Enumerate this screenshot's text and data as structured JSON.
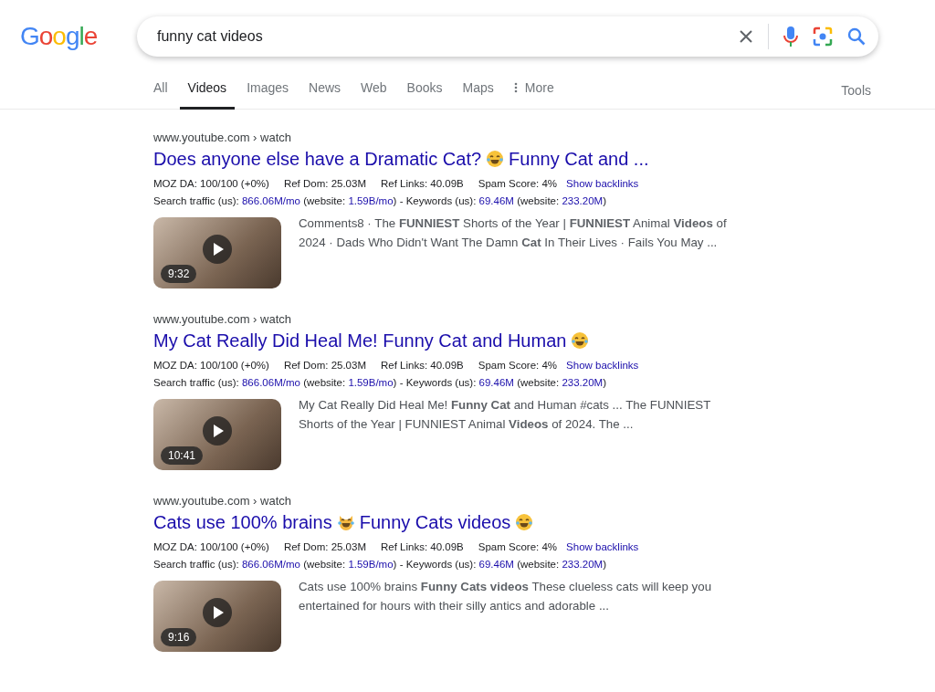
{
  "logo": {
    "letters": [
      "G",
      "o",
      "o",
      "g",
      "l",
      "e"
    ]
  },
  "search": {
    "value": "funny cat videos"
  },
  "tabs": [
    {
      "label": "All",
      "selected": false,
      "kind": "tab"
    },
    {
      "label": "Videos",
      "selected": true,
      "kind": "tab"
    },
    {
      "label": "Images",
      "selected": false,
      "kind": "tab"
    },
    {
      "label": "News",
      "selected": false,
      "kind": "tab"
    },
    {
      "label": "Web",
      "selected": false,
      "kind": "tab"
    },
    {
      "label": "Books",
      "selected": false,
      "kind": "tab"
    },
    {
      "label": "Maps",
      "selected": false,
      "kind": "tab"
    },
    {
      "label": "More",
      "selected": false,
      "kind": "more"
    }
  ],
  "tools": "Tools",
  "results": [
    {
      "url": "www.youtube.com › watch",
      "title_parts": [
        {
          "kind": "text",
          "text": "Does anyone else have a Dramatic Cat?"
        },
        {
          "kind": "laugh-emoji"
        },
        {
          "kind": "text",
          "text": "Funny Cat and ..."
        }
      ],
      "metrics": [
        "MOZ DA: 100/100 (+0%)",
        "Ref Dom: 25.03M",
        "Ref Links: 40.09B",
        "Spam Score: 4%"
      ],
      "backlinks": "Show backlinks",
      "traffic": [
        {
          "kind": "label",
          "text": "Search traffic (us):"
        },
        {
          "kind": "value",
          "text": "866.06M/mo"
        },
        {
          "kind": "label",
          "text": "(website:"
        },
        {
          "kind": "value",
          "text": "1.59B/mo"
        },
        {
          "kind": "label",
          "text": ") - Keywords (us):"
        },
        {
          "kind": "value",
          "text": "69.46M"
        },
        {
          "kind": "label",
          "text": "(website:"
        },
        {
          "kind": "value",
          "text": "233.20M"
        },
        {
          "kind": "label",
          "text": ")"
        }
      ],
      "duration": "9:32",
      "snippet": "Comments8 · The **FUNNIEST** Shorts of the Year | **FUNNIEST** Animal **Videos** of 2024 · Dads Who Didn't Want The Damn **Cat** In Their Lives · Fails You May ..."
    },
    {
      "url": "www.youtube.com › watch",
      "title_parts": [
        {
          "kind": "text",
          "text": "My Cat Really Did Heal Me! Funny Cat and Human"
        },
        {
          "kind": "laugh-emoji"
        }
      ],
      "metrics": [
        "MOZ DA: 100/100 (+0%)",
        "Ref Dom: 25.03M",
        "Ref Links: 40.09B",
        "Spam Score: 4%"
      ],
      "backlinks": "Show backlinks",
      "traffic": [
        {
          "kind": "label",
          "text": "Search traffic (us):"
        },
        {
          "kind": "value",
          "text": "866.06M/mo"
        },
        {
          "kind": "label",
          "text": "(website:"
        },
        {
          "kind": "value",
          "text": "1.59B/mo"
        },
        {
          "kind": "label",
          "text": ") - Keywords (us):"
        },
        {
          "kind": "value",
          "text": "69.46M"
        },
        {
          "kind": "label",
          "text": "(website:"
        },
        {
          "kind": "value",
          "text": "233.20M"
        },
        {
          "kind": "label",
          "text": ")"
        }
      ],
      "duration": "10:41",
      "snippet": "My Cat Really Did Heal Me! **Funny Cat** and Human #cats ... The FUNNIEST Shorts of the Year | FUNNIEST Animal **Videos** of 2024. The ..."
    },
    {
      "url": "www.youtube.com › watch",
      "title_parts": [
        {
          "kind": "text",
          "text": "Cats use 100% brains"
        },
        {
          "kind": "cat-emoji"
        },
        {
          "kind": "text",
          "text": "Funny Cats videos"
        },
        {
          "kind": "laugh-emoji"
        }
      ],
      "metrics": [
        "MOZ DA: 100/100 (+0%)",
        "Ref Dom: 25.03M",
        "Ref Links: 40.09B",
        "Spam Score: 4%"
      ],
      "backlinks": "Show backlinks",
      "traffic": [
        {
          "kind": "label",
          "text": "Search traffic (us):"
        },
        {
          "kind": "value",
          "text": "866.06M/mo"
        },
        {
          "kind": "label",
          "text": "(website:"
        },
        {
          "kind": "value",
          "text": "1.59B/mo"
        },
        {
          "kind": "label",
          "text": ") - Keywords (us):"
        },
        {
          "kind": "value",
          "text": "69.46M"
        },
        {
          "kind": "label",
          "text": "(website:"
        },
        {
          "kind": "value",
          "text": "233.20M"
        },
        {
          "kind": "label",
          "text": ")"
        }
      ],
      "duration": "9:16",
      "snippet": "Cats use 100% brains **Funny Cats videos** These clueless cats will keep you entertained for hours with their silly antics and adorable ..."
    }
  ]
}
